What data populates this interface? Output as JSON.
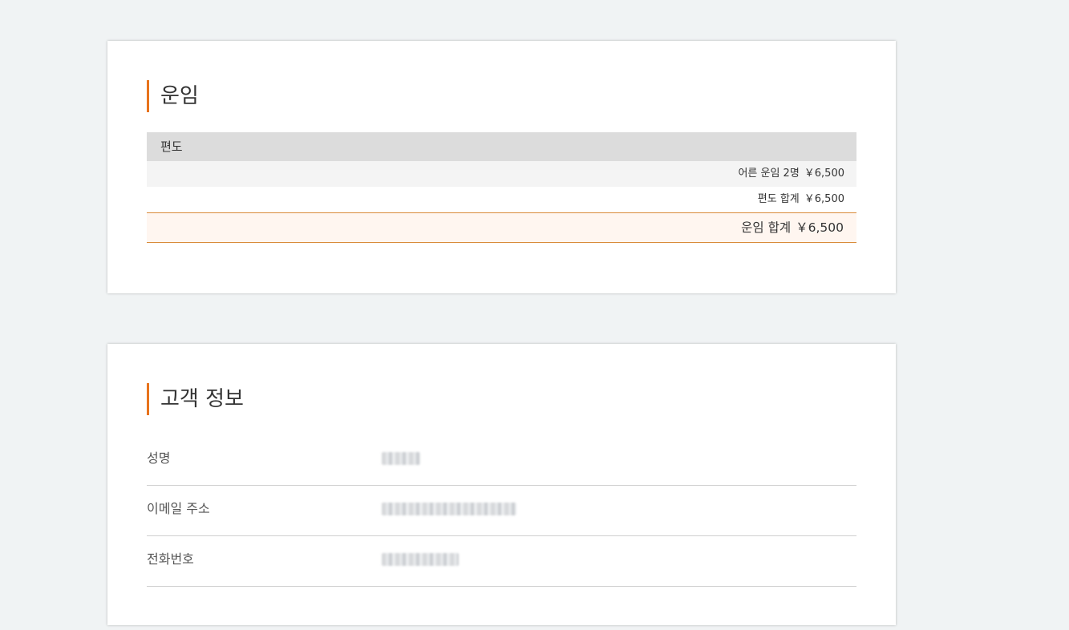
{
  "fare": {
    "title": "운임",
    "header": "편도",
    "rows": [
      {
        "label": "어른 운임 2명",
        "amount": "￥6,500"
      },
      {
        "label": "편도 합계",
        "amount": "￥6,500"
      }
    ],
    "total": {
      "label": "운임 합계",
      "amount": "￥6,500"
    }
  },
  "customer": {
    "title": "고객 정보",
    "fields": [
      {
        "label": "성명",
        "value": ""
      },
      {
        "label": "이메일 주소",
        "value": ""
      },
      {
        "label": "전화번호",
        "value": ""
      }
    ]
  },
  "colors": {
    "accent": "#e8731c",
    "background": "#f0f3f4",
    "table_header": "#dcdcdc",
    "total_row": "#fff6f0"
  }
}
